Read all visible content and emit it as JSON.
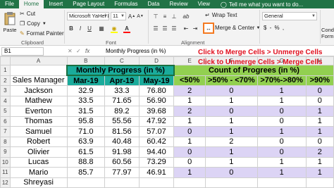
{
  "tabs": [
    "File",
    "Home",
    "Insert",
    "Page Layout",
    "Formulas",
    "Data",
    "Review",
    "View"
  ],
  "active_tab": "Home",
  "tell_me": "Tell me what you want to do...",
  "ribbon": {
    "cut": "Cut",
    "copy": "Copy",
    "format_painter": "Format Painter",
    "paste": "Paste",
    "clipboard_label": "Clipboard",
    "font_name": "Microsoft YaHei L",
    "font_size": "11",
    "bold": "B",
    "italic": "I",
    "underline": "U",
    "font_label": "Font",
    "wrap_text": "Wrap Text",
    "merge_center": "Merge & Center",
    "alignment_label": "Alignment",
    "number_format": "General",
    "number_symbols": "$ - % ,",
    "cond_format": "Cond Form",
    "accent_color": "#217346",
    "highlight_color": "#f47920"
  },
  "formula_bar": {
    "name_box": "B1",
    "fx": "fx",
    "value": "Monthly Progress (in %)"
  },
  "callouts": [
    "Click to Merge Cells > Unmerge Cells",
    "Click to Unmerge Cells > Merge Cells"
  ],
  "columns": [
    "A",
    "B",
    "C",
    "D",
    "E",
    "F",
    "G",
    "H"
  ],
  "row_numbers": [
    "1",
    "2",
    "3",
    "4",
    "5",
    "6",
    "7",
    "8",
    "9",
    "10",
    "11",
    "12"
  ],
  "sheet": {
    "merged_header_left": "Monthly Progress (in %)",
    "merged_header_right": "Count of Progrees (in %)",
    "col_headers": [
      "Sales Manager",
      "Mar-19",
      "Apr-19",
      "May-19",
      "<50%",
      ">50% - <70%",
      ">70%->80%",
      ">90%"
    ],
    "rows": [
      [
        "Jackson",
        "32.9",
        "33.3",
        "76.80",
        "2",
        "0",
        "1",
        "0"
      ],
      [
        "Mathew",
        "33.5",
        "71.65",
        "56.90",
        "1",
        "1",
        "1",
        "0"
      ],
      [
        "Everton",
        "31.5",
        "89.2",
        "39.68",
        "2",
        "0",
        "0",
        "1"
      ],
      [
        "Thomas",
        "95.8",
        "55.56",
        "47.92",
        "1",
        "1",
        "0",
        "1"
      ],
      [
        "Samuel",
        "71.0",
        "81.56",
        "57.07",
        "0",
        "1",
        "1",
        "1"
      ],
      [
        "Robert",
        "63.9",
        "40.48",
        "60.42",
        "1",
        "2",
        "0",
        "0"
      ],
      [
        "Olivier",
        "61.5",
        "91.98",
        "94.40",
        "0",
        "1",
        "0",
        "2"
      ],
      [
        "Lucas",
        "88.8",
        "60.56",
        "73.29",
        "0",
        "1",
        "1",
        "1"
      ],
      [
        "Mario",
        "85.7",
        "77.97",
        "46.91",
        "1",
        "0",
        "1",
        "1"
      ],
      [
        "Shreyasi",
        "",
        "",
        "",
        "",
        "",
        "",
        ""
      ]
    ]
  }
}
